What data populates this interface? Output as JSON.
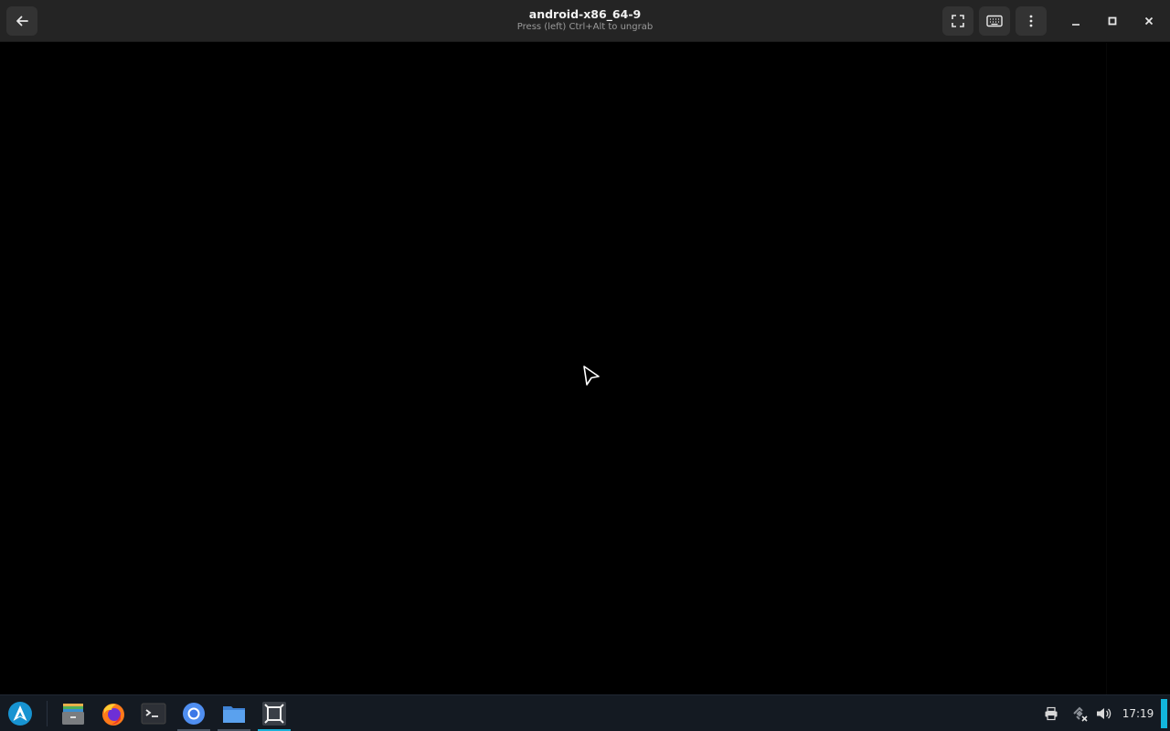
{
  "window": {
    "title": "android-x86_64-9",
    "subtitle": "Press (left) Ctrl+Alt to ungrab",
    "buttons": {
      "back": "back-arrow-icon",
      "fullscreen": "fullscreen-icon",
      "keyboard": "keyboard-icon",
      "menu": "kebab-menu-icon",
      "minimize": "minimize-icon",
      "maximize": "maximize-icon",
      "close": "close-icon"
    }
  },
  "taskbar": {
    "launcher": "arch-launcher-icon",
    "apps": [
      {
        "name": "archive-manager",
        "icon": "archive-icon",
        "open": false
      },
      {
        "name": "firefox",
        "icon": "firefox-icon",
        "open": false
      },
      {
        "name": "terminal",
        "icon": "terminal-icon",
        "open": false
      },
      {
        "name": "chromium",
        "icon": "chromium-icon",
        "open": true
      },
      {
        "name": "file-manager",
        "icon": "folder-icon",
        "open": true
      },
      {
        "name": "virtual-machine-manager",
        "icon": "vm-icon",
        "open": true,
        "active": true
      }
    ],
    "tray": [
      "printer-icon",
      "network-disconnected-icon",
      "volume-icon"
    ],
    "clock": "17:19"
  },
  "colors": {
    "titlebar": "#242424",
    "display": "#000000",
    "taskbar": "#141a22",
    "accent": "#12b6dc"
  }
}
